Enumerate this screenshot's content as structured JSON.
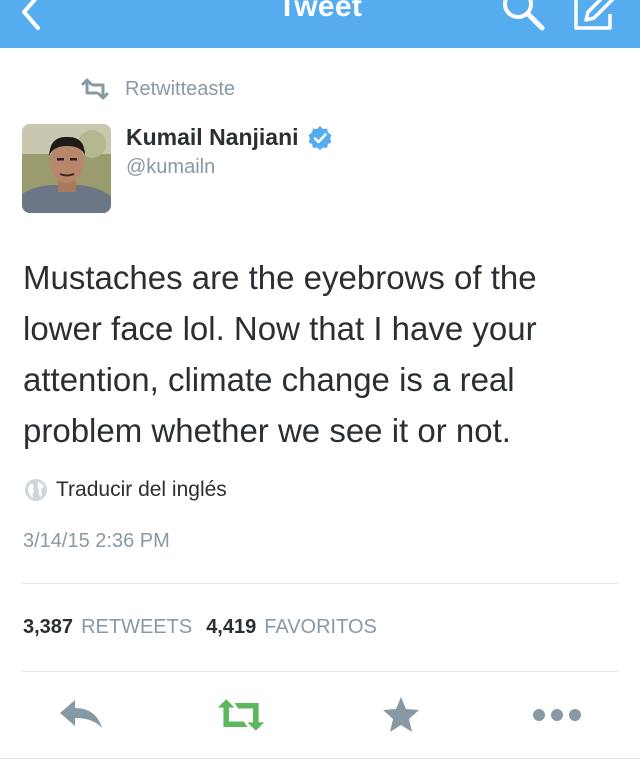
{
  "nav": {
    "title": "Tweet",
    "back_icon": "chevron-left-icon",
    "search_icon": "search-icon",
    "compose_icon": "compose-icon"
  },
  "retweet_context": {
    "label": "Retwitteaste",
    "icon": "retweet-icon"
  },
  "author": {
    "name": "Kumail Nanjiani",
    "handle": "@kumailn",
    "verified": true
  },
  "tweet": {
    "text": "Mustaches are the eyebrows of the lower face lol. Now that I have your attention, climate change is a real problem whether we see it or not.",
    "translate_label": "Traducir del inglés",
    "timestamp": "3/14/15 2:36 PM"
  },
  "stats": {
    "retweets_count": "3,387",
    "retweets_label": "RETWEETS",
    "favorites_count": "4,419",
    "favorites_label": "FAVORITOS"
  },
  "actions": {
    "reply_icon": "reply-icon",
    "retweet_icon": "retweet-icon",
    "favorite_icon": "star-icon",
    "more_icon": "more-icon"
  },
  "colors": {
    "nav_bg": "#55acee",
    "retweet_green": "#5cb85c",
    "muted": "#8899a6",
    "verified_blue": "#55acee"
  }
}
